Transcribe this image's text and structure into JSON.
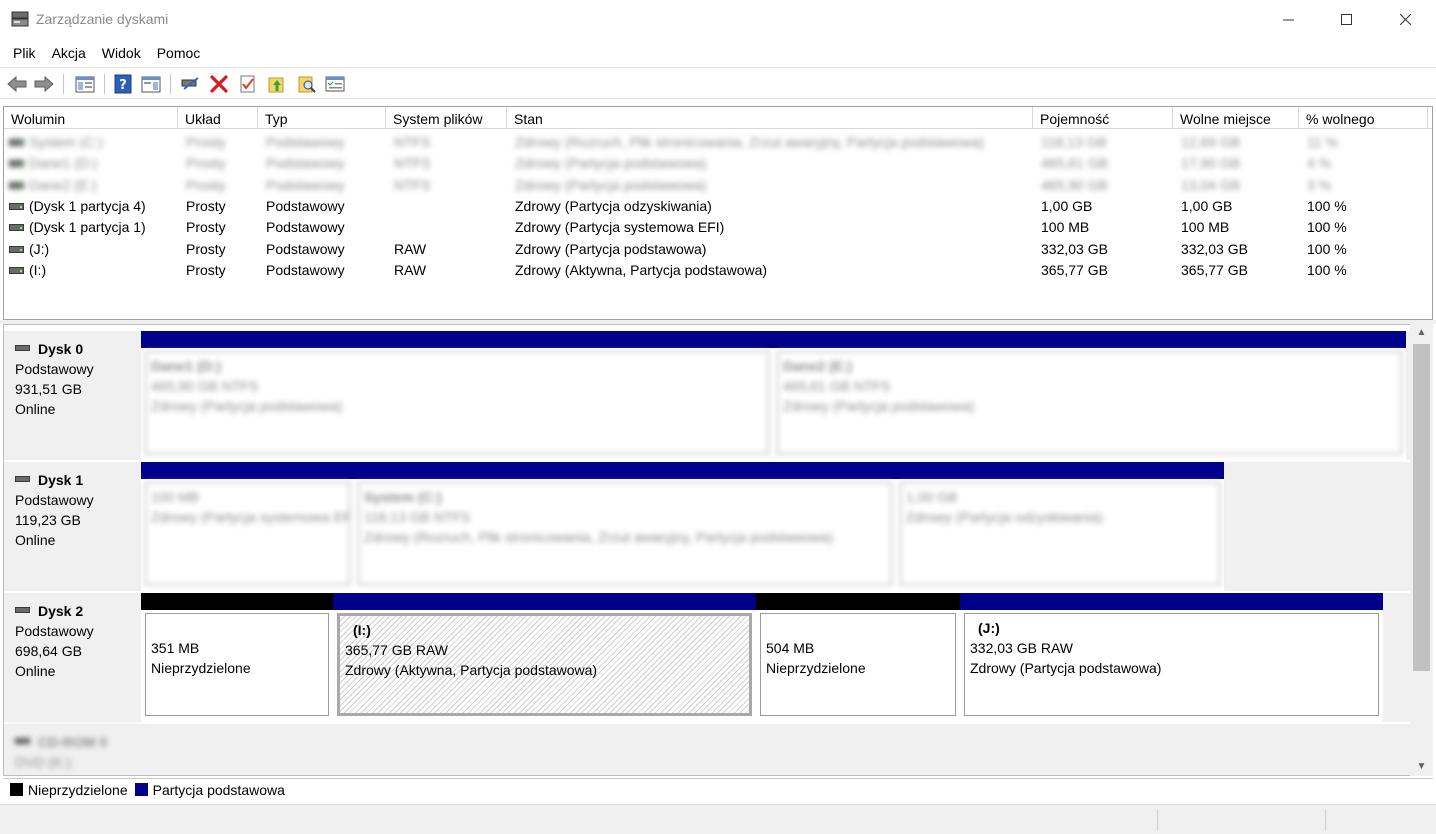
{
  "window": {
    "title": "Zarządzanie dyskami",
    "minimize": "—",
    "maximize": "☐",
    "close": "✕"
  },
  "menu": [
    "Plik",
    "Akcja",
    "Widok",
    "Pomoc"
  ],
  "columns": [
    "Wolumin",
    "Układ",
    "Typ",
    "System plików",
    "Stan",
    "Pojemność",
    "Wolne miejsce",
    "% wolnego"
  ],
  "volumes": [
    {
      "name": "System (C:)",
      "layout": "Prosty",
      "type": "Podstawowy",
      "fs": "NTFS",
      "status": "Zdrowy (Rozruch, Plik stronicowania, Zrzut awaryjny, Partycja podstawowa)",
      "capacity": "118,13 GB",
      "free": "12,69 GB",
      "pct": "11 %",
      "blurred": true
    },
    {
      "name": "Dane1 (D:)",
      "layout": "Prosty",
      "type": "Podstawowy",
      "fs": "NTFS",
      "status": "Zdrowy (Partycja podstawowa)",
      "capacity": "465,61 GB",
      "free": "17,90 GB",
      "pct": "4 %",
      "blurred": true
    },
    {
      "name": "Dane2 (E:)",
      "layout": "Prosty",
      "type": "Podstawowy",
      "fs": "NTFS",
      "status": "Zdrowy (Partycja podstawowa)",
      "capacity": "465,90 GB",
      "free": "13,04 GB",
      "pct": "3 %",
      "blurred": true
    },
    {
      "name": "(Dysk 1 partycja 4)",
      "layout": "Prosty",
      "type": "Podstawowy",
      "fs": "",
      "status": "Zdrowy (Partycja odzyskiwania)",
      "capacity": "1,00 GB",
      "free": "1,00 GB",
      "pct": "100 %",
      "blurred": false
    },
    {
      "name": "(Dysk 1 partycja 1)",
      "layout": "Prosty",
      "type": "Podstawowy",
      "fs": "",
      "status": "Zdrowy (Partycja systemowa EFI)",
      "capacity": "100 MB",
      "free": "100 MB",
      "pct": "100 %",
      "blurred": false
    },
    {
      "name": "(J:)",
      "layout": "Prosty",
      "type": "Podstawowy",
      "fs": "RAW",
      "status": "Zdrowy (Partycja podstawowa)",
      "capacity": "332,03 GB",
      "free": "332,03 GB",
      "pct": "100 %",
      "blurred": false
    },
    {
      "name": "(I:)",
      "layout": "Prosty",
      "type": "Podstawowy",
      "fs": "RAW",
      "status": "Zdrowy (Aktywna, Partycja podstawowa)",
      "capacity": "365,77 GB",
      "free": "365,77 GB",
      "pct": "100 %",
      "blurred": false
    }
  ],
  "disks": [
    {
      "name": "Dysk 0",
      "type": "Podstawowy",
      "size": "931,51 GB",
      "state": "Online",
      "partitions": [
        {
          "bar": "blue",
          "name": "Dane1  (D:)",
          "line2": "465,90 GB NTFS",
          "line3": "Zdrowy (Partycja podstawowa)",
          "blurred": true
        },
        {
          "bar": "blue",
          "name": "Dane2  (E:)",
          "line2": "465,61 GB NTFS",
          "line3": "Zdrowy (Partycja podstawowa)",
          "blurred": true
        }
      ]
    },
    {
      "name": "Dysk 1",
      "type": "Podstawowy",
      "size": "119,23 GB",
      "state": "Online",
      "partitions": [
        {
          "bar": "blue",
          "name": "",
          "line2": "100 MB",
          "line3": "Zdrowy (Partycja systemowa EFI)",
          "blurred": true
        },
        {
          "bar": "blue",
          "name": "System  (C:)",
          "line2": "118,13 GB NTFS",
          "line3": "Zdrowy (Rozruch, Plik stronicowania, Zrzut awaryjny, Partycja podstawowa)",
          "blurred": true
        },
        {
          "bar": "blue",
          "name": "",
          "line2": "1,00 GB",
          "line3": "Zdrowy (Partycja odzyskiwania)",
          "blurred": true
        }
      ]
    },
    {
      "name": "Dysk 2",
      "type": "Podstawowy",
      "size": "698,64 GB",
      "state": "Online",
      "partitions": [
        {
          "bar": "black",
          "name": "",
          "line2": "351 MB",
          "line3": "Nieprzydzielone",
          "blurred": false
        },
        {
          "bar": "blue",
          "name": "(I:)",
          "line2": "365,77 GB RAW",
          "line3": "Zdrowy (Aktywna, Partycja podstawowa)",
          "blurred": false,
          "selected": true
        },
        {
          "bar": "black",
          "name": "",
          "line2": "504 MB",
          "line3": "Nieprzydzielone",
          "blurred": false
        },
        {
          "bar": "blue",
          "name": "(J:)",
          "line2": "332,03 GB RAW",
          "line3": "Zdrowy (Partycja podstawowa)",
          "blurred": false
        }
      ]
    },
    {
      "name": "CD-ROM 0",
      "type": "DVD (K:)",
      "size": "",
      "state": "",
      "blurred": true,
      "partitions": []
    }
  ],
  "legend": [
    {
      "label": "Nieprzydzielone",
      "color": "#000000"
    },
    {
      "label": "Partycja podstawowa",
      "color": "#00008b"
    }
  ],
  "colors": {
    "primary_partition": "#00008b",
    "unallocated": "#000000"
  }
}
